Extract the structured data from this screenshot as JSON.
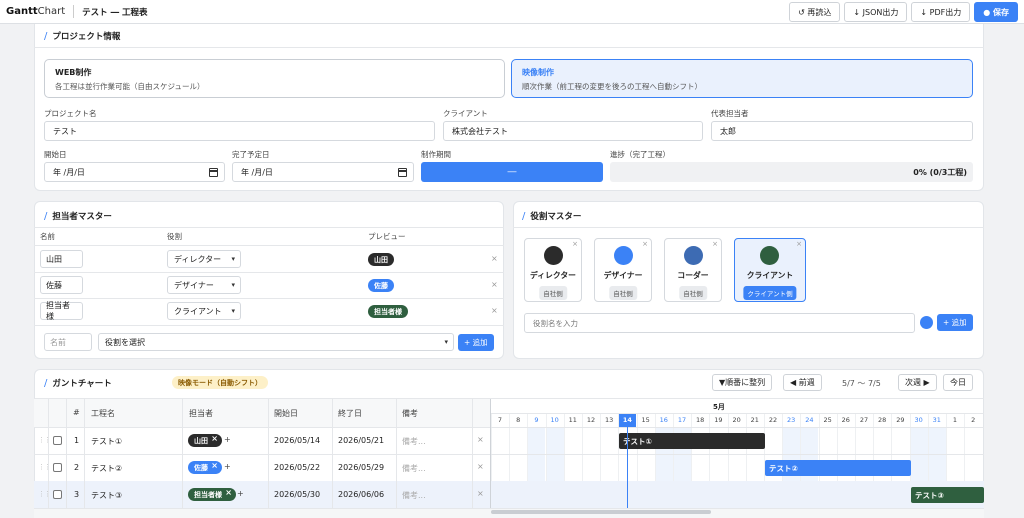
{
  "header": {
    "logo_bold": "Gantt",
    "logo_rest": "Chart",
    "title": "テスト ― 工程表",
    "reload": "↺ 再読込",
    "json": "↓ JSON出力",
    "pdf": "↓ PDF出力",
    "save": "● 保存"
  },
  "project": {
    "section": "プロジェクト情報",
    "mode_web": {
      "title": "WEB制作",
      "desc": "各工程は並行作業可能（自由スケジュール）"
    },
    "mode_video": {
      "title": "映像制作",
      "desc": "順次作業（前工程の変更を後ろの工程へ自動シフト）"
    },
    "name_label": "プロジェクト名",
    "name_value": "テスト",
    "client_label": "クライアント",
    "client_value": "株式会社テスト",
    "rep_label": "代表担当者",
    "rep_value": "太郎",
    "start_label": "開始日",
    "start_value": "年 /月/日",
    "end_label": "完了予定日",
    "end_value": "年 /月/日",
    "period_label": "制作期間",
    "period_value": "―",
    "progress_label": "進捗（完了工程）",
    "progress_value": "0% (0/3工程)"
  },
  "assignee": {
    "section": "担当者マスター",
    "col_name": "名前",
    "col_role": "役割",
    "col_preview": "プレビュー",
    "rows": [
      {
        "name": "山田",
        "role": "ディレクター",
        "preview": "山田",
        "color": "#2b2b2b"
      },
      {
        "name": "佐藤",
        "role": "デザイナー",
        "preview": "佐藤",
        "color": "#3b82f6"
      },
      {
        "name": "担当者様",
        "role": "クライアント",
        "preview": "担当者様",
        "color": "#2f5f3f"
      }
    ],
    "new_name_ph": "名前",
    "new_role_ph": "役割を選択",
    "add": "+ 追加"
  },
  "roles": {
    "section": "役割マスター",
    "items": [
      {
        "name": "ディレクター",
        "tag": "自社側",
        "color": "#2b2b2b"
      },
      {
        "name": "デザイナー",
        "tag": "自社側",
        "color": "#3b82f6"
      },
      {
        "name": "コーダー",
        "tag": "自社側",
        "color": "#3d6bb3"
      },
      {
        "name": "クライアント",
        "tag": "クライアント側",
        "color": "#2f5f3f"
      }
    ],
    "input_ph": "役割名を入力",
    "add": "+ 追加"
  },
  "gantt": {
    "section": "ガントチャート",
    "mode_badge": "映像モード（自動シフト）",
    "sort": "▼順番に整列",
    "prev": "◀ 前週",
    "range": "5/7 〜 7/5",
    "next": "次週 ▶",
    "today": "今日",
    "month": "5月",
    "cols": {
      "num": "#",
      "task": "工程名",
      "assignee": "担当者",
      "start": "開始日",
      "end": "終了日",
      "note": "備考"
    },
    "days": [
      "7",
      "8",
      "9",
      "10",
      "11",
      "12",
      "13",
      "14",
      "15",
      "16",
      "17",
      "18",
      "19",
      "20",
      "21",
      "22",
      "23",
      "24",
      "25",
      "26",
      "27",
      "28",
      "29",
      "30",
      "31",
      "1",
      "2"
    ],
    "today_day": "14",
    "tasks": [
      {
        "num": "1",
        "name": "テスト①",
        "assignee": "山田",
        "color": "#2b2b2b",
        "start": "2026/05/14",
        "end": "2026/05/21",
        "note": "備考...",
        "bar": "テスト①"
      },
      {
        "num": "2",
        "name": "テスト②",
        "assignee": "佐藤",
        "color": "#3b82f6",
        "start": "2026/05/22",
        "end": "2026/05/29",
        "note": "備考...",
        "bar": "テスト②"
      },
      {
        "num": "3",
        "name": "テスト③",
        "assignee": "担当者様",
        "color": "#2f5f3f",
        "start": "2026/05/30",
        "end": "2026/06/06",
        "note": "備考...",
        "bar": "テスト③"
      }
    ]
  }
}
